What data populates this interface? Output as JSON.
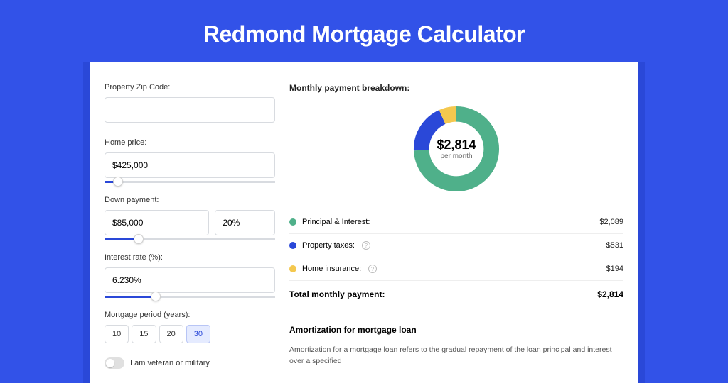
{
  "title": "Redmond Mortgage Calculator",
  "form": {
    "zip": {
      "label": "Property Zip Code:",
      "value": ""
    },
    "price": {
      "label": "Home price:",
      "value": "$425,000",
      "sliderPct": 8
    },
    "down": {
      "label": "Down payment:",
      "value": "$85,000",
      "pct": "20%",
      "sliderPct": 20
    },
    "rate": {
      "label": "Interest rate (%):",
      "value": "6.230%",
      "sliderPct": 30
    },
    "period": {
      "label": "Mortgage period (years):",
      "options": [
        "10",
        "15",
        "20",
        "30"
      ],
      "active": "30"
    },
    "veteran": {
      "label": "I am veteran or military",
      "on": false
    }
  },
  "breakdown": {
    "title": "Monthly payment breakdown:",
    "center_amount": "$2,814",
    "center_sub": "per month",
    "items": [
      {
        "label": "Principal & Interest:",
        "value": "$2,089",
        "color": "#4fb08a",
        "info": false
      },
      {
        "label": "Property taxes:",
        "value": "$531",
        "color": "#2a48d8",
        "info": true
      },
      {
        "label": "Home insurance:",
        "value": "$194",
        "color": "#f4c84f",
        "info": true
      }
    ],
    "total": {
      "label": "Total monthly payment:",
      "value": "$2,814"
    }
  },
  "chart_data": {
    "type": "pie",
    "title": "Monthly payment breakdown",
    "series": [
      {
        "name": "Principal & Interest",
        "value": 2089,
        "color": "#4fb08a"
      },
      {
        "name": "Property taxes",
        "value": 531,
        "color": "#2a48d8"
      },
      {
        "name": "Home insurance",
        "value": 194,
        "color": "#f4c84f"
      }
    ],
    "total": 2814,
    "center_label": "$2,814 per month"
  },
  "amort": {
    "title": "Amortization for mortgage loan",
    "text": "Amortization for a mortgage loan refers to the gradual repayment of the loan principal and interest over a specified"
  },
  "colors": {
    "accent": "#2a48d8",
    "green": "#4fb08a",
    "yellow": "#f4c84f"
  }
}
